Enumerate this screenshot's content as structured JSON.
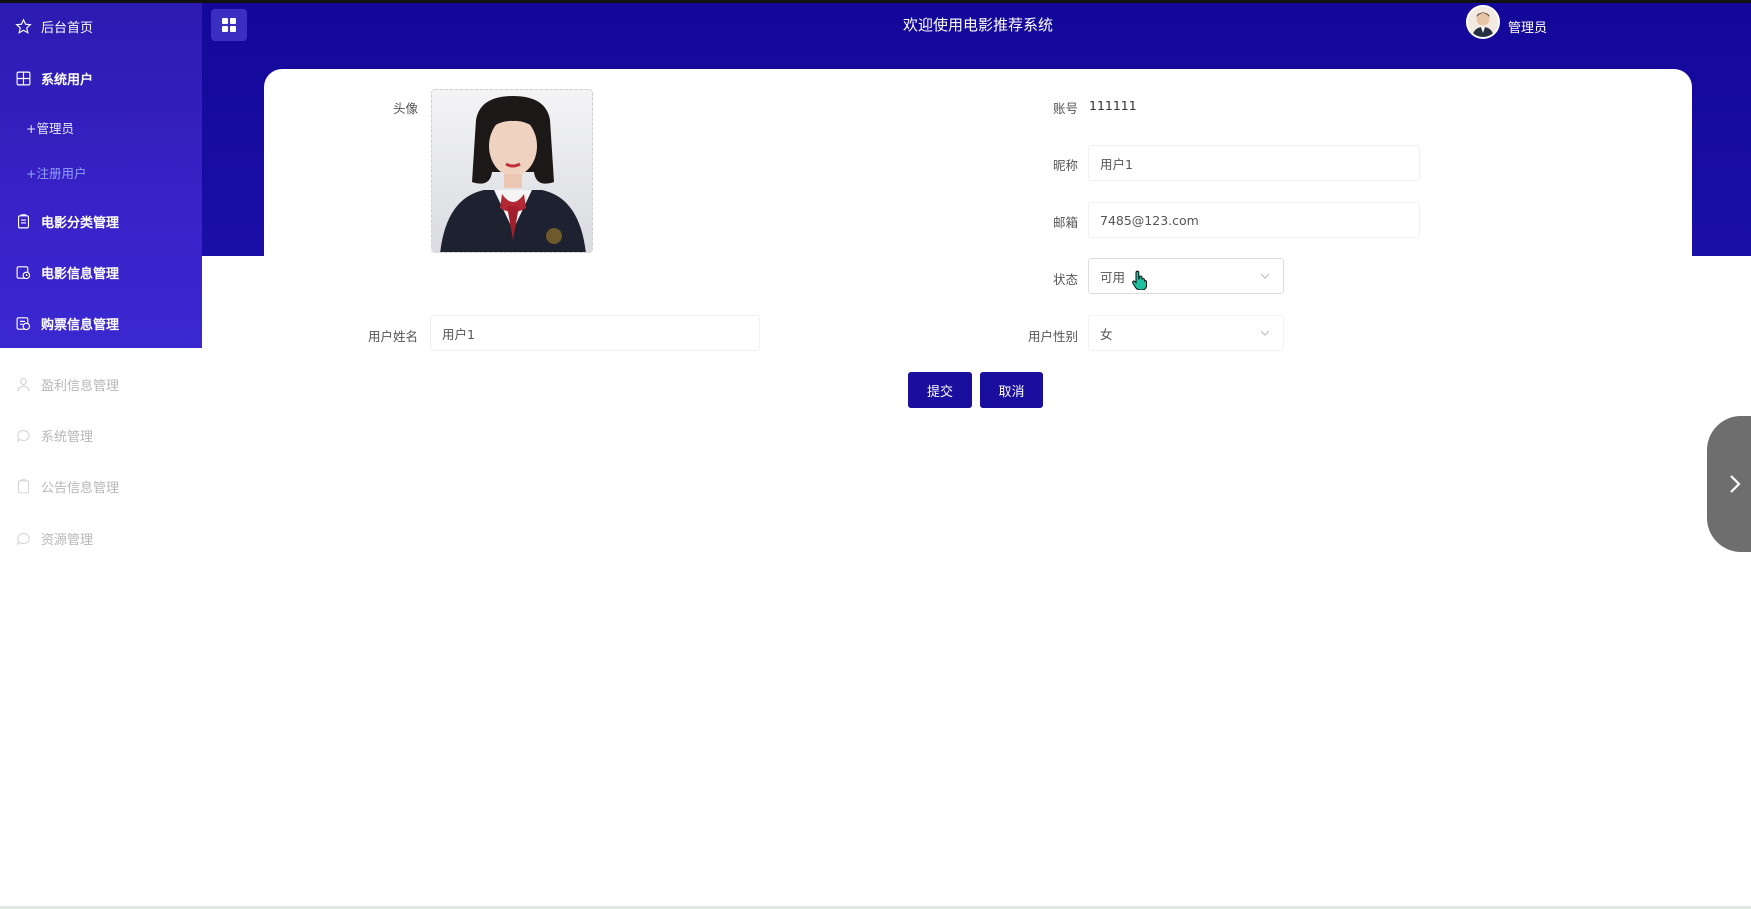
{
  "header": {
    "title": "欢迎使用电影推荐系统",
    "admin_name": "管理员"
  },
  "sidebar": {
    "items": [
      {
        "label": "后台首页",
        "icon": "star-icon"
      },
      {
        "label": "系统用户",
        "icon": "grid-icon"
      },
      {
        "label": "+管理员"
      },
      {
        "label": "+注册用户"
      },
      {
        "label": "电影分类管理",
        "icon": "clipboard-icon"
      },
      {
        "label": "电影信息管理",
        "icon": "film-icon"
      },
      {
        "label": "购票信息管理",
        "icon": "ticket-icon"
      },
      {
        "label": "盈利信息管理",
        "icon": "user-icon"
      },
      {
        "label": "系统管理",
        "icon": "chat-icon"
      },
      {
        "label": "公告信息管理",
        "icon": "clipboard-icon"
      },
      {
        "label": "资源管理",
        "icon": "chat-icon"
      }
    ]
  },
  "form": {
    "avatar_label": "头像",
    "account_label": "账号",
    "account_value": "111111",
    "nickname_label": "昵称",
    "nickname_value": "用户1",
    "email_label": "邮箱",
    "email_value": "7485@123.com",
    "status_label": "状态",
    "status_value": "可用",
    "username_label": "用户姓名",
    "username_value": "用户1",
    "gender_label": "用户性别",
    "gender_value": "女",
    "submit_label": "提交",
    "cancel_label": "取消"
  },
  "colors": {
    "header_bg": "#14089a",
    "sidebar_bg": "#2b1bb0",
    "button_bg": "#1a0e9e",
    "active_sub": "#8fa2ff"
  }
}
